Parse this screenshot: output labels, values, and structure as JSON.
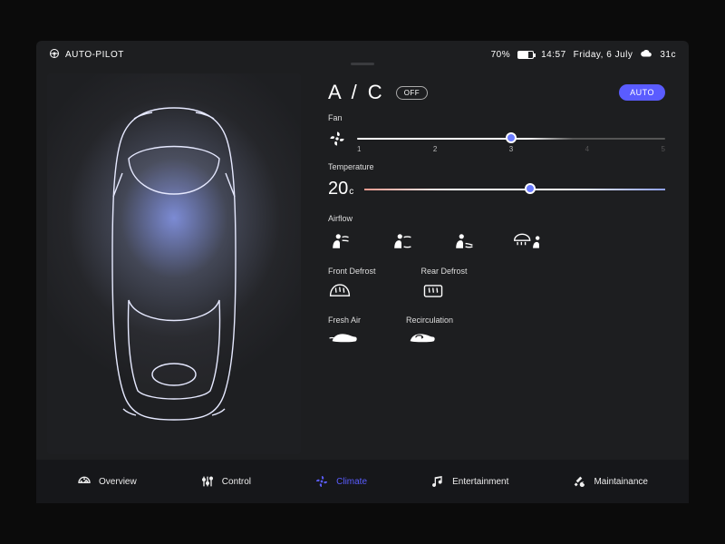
{
  "status": {
    "mode": "AUTO-PILOT",
    "battery_pct": "70%",
    "time": "14:57",
    "date": "Friday, 6 July",
    "outside_temp": "31c"
  },
  "ac": {
    "title": "A / C",
    "toggle": "OFF",
    "auto": "AUTO"
  },
  "fan": {
    "label": "Fan",
    "value": 3,
    "ticks": [
      "1",
      "2",
      "3",
      "4",
      "5"
    ]
  },
  "temperature": {
    "label": "Temperature",
    "value": "20",
    "unit": "c",
    "slider_pct": 55
  },
  "airflow": {
    "label": "Airflow",
    "options": [
      "face",
      "face-feet",
      "feet",
      "windshield-face"
    ]
  },
  "defrost": {
    "front": "Front Defrost",
    "rear": "Rear Defrost"
  },
  "intake": {
    "fresh": "Fresh Air",
    "recirc": "Recirculation"
  },
  "nav": {
    "overview": "Overview",
    "control": "Control",
    "climate": "Climate",
    "entertainment": "Entertainment",
    "maintenance": "Maintainance"
  },
  "colors": {
    "accent": "#5a5cff"
  }
}
